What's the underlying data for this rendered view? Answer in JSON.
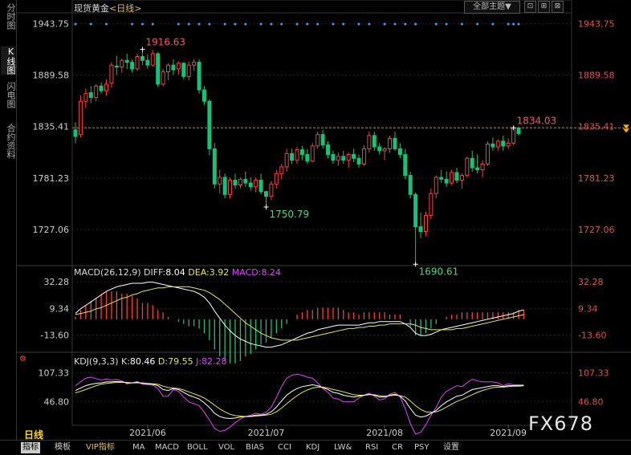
{
  "header": {
    "title": "现货黄金",
    "period_tag": "<日线>",
    "theme_button": "全部主题▼",
    "win_buttons": [
      "⊡",
      "⊞",
      "⊠"
    ]
  },
  "side_tabs": [
    "分时图",
    "K线图",
    "闪电图",
    "合约资料"
  ],
  "colors": {
    "up": "#ff3b3b",
    "down": "#18c07a",
    "last_line": "#ff6a00",
    "diff": "#ffffff",
    "dea": "#e8e83a",
    "macd_label": "#e040fb",
    "k": "#ffffff",
    "d": "#e8e83a",
    "j": "#e040fb",
    "marker": "#3aa0ff"
  },
  "chart_data": [
    {
      "type": "candlestick",
      "title": "现货黄金 <日线>",
      "y_ticks": [
        1943.75,
        1889.58,
        1835.41,
        1781.23,
        1727.06
      ],
      "ylim": [
        1690,
        1955
      ],
      "x_ticks": [
        "2021/06",
        "2021/07",
        "2021/08",
        "2021/09"
      ],
      "last_price": 1834.03,
      "annotations": [
        {
          "label": "1916.63",
          "value": 1916.63,
          "kind": "high"
        },
        {
          "label": "1750.79",
          "value": 1750.79,
          "kind": "low"
        },
        {
          "label": "1690.61",
          "value": 1690.61,
          "kind": "low"
        },
        {
          "label": "1834.03",
          "value": 1834.03,
          "kind": "high"
        }
      ],
      "candles": [
        [
          1832,
          1840,
          1818,
          1825
        ],
        [
          1827,
          1868,
          1824,
          1862
        ],
        [
          1862,
          1875,
          1855,
          1870
        ],
        [
          1871,
          1878,
          1860,
          1866
        ],
        [
          1866,
          1880,
          1862,
          1878
        ],
        [
          1878,
          1882,
          1870,
          1873
        ],
        [
          1873,
          1885,
          1868,
          1880
        ],
        [
          1881,
          1903,
          1876,
          1900
        ],
        [
          1899,
          1910,
          1890,
          1898
        ],
        [
          1898,
          1907,
          1892,
          1905
        ],
        [
          1905,
          1912,
          1896,
          1903
        ],
        [
          1903,
          1906,
          1892,
          1896
        ],
        [
          1896,
          1912,
          1894,
          1909
        ],
        [
          1909,
          1916,
          1900,
          1905
        ],
        [
          1905,
          1911,
          1896,
          1900
        ],
        [
          1900,
          1916,
          1898,
          1912
        ],
        [
          1912,
          1914,
          1877,
          1880
        ],
        [
          1880,
          1896,
          1878,
          1893
        ],
        [
          1893,
          1902,
          1884,
          1900
        ],
        [
          1900,
          1906,
          1890,
          1895
        ],
        [
          1896,
          1904,
          1890,
          1902
        ],
        [
          1902,
          1903,
          1885,
          1888
        ],
        [
          1888,
          1904,
          1884,
          1900
        ],
        [
          1900,
          1906,
          1894,
          1903
        ],
        [
          1903,
          1906,
          1870,
          1874
        ],
        [
          1874,
          1878,
          1858,
          1862
        ],
        [
          1862,
          1864,
          1805,
          1812
        ],
        [
          1812,
          1818,
          1770,
          1775
        ],
        [
          1775,
          1790,
          1765,
          1782
        ],
        [
          1782,
          1786,
          1760,
          1764
        ],
        [
          1764,
          1782,
          1760,
          1779
        ],
        [
          1779,
          1786,
          1770,
          1774
        ],
        [
          1774,
          1782,
          1770,
          1780
        ],
        [
          1780,
          1788,
          1772,
          1776
        ],
        [
          1776,
          1782,
          1768,
          1772
        ],
        [
          1772,
          1782,
          1766,
          1779
        ],
        [
          1779,
          1786,
          1764,
          1767
        ],
        [
          1767,
          1768,
          1750,
          1762
        ],
        [
          1762,
          1778,
          1758,
          1775
        ],
        [
          1775,
          1790,
          1770,
          1786
        ],
        [
          1786,
          1796,
          1780,
          1793
        ],
        [
          1793,
          1812,
          1788,
          1807
        ],
        [
          1807,
          1812,
          1796,
          1800
        ],
        [
          1800,
          1814,
          1796,
          1811
        ],
        [
          1811,
          1815,
          1800,
          1806
        ],
        [
          1806,
          1812,
          1796,
          1799
        ],
        [
          1799,
          1818,
          1798,
          1815
        ],
        [
          1815,
          1830,
          1812,
          1827
        ],
        [
          1827,
          1832,
          1812,
          1816
        ],
        [
          1816,
          1820,
          1802,
          1806
        ],
        [
          1806,
          1810,
          1796,
          1800
        ],
        [
          1800,
          1808,
          1794,
          1804
        ],
        [
          1804,
          1810,
          1796,
          1800
        ],
        [
          1800,
          1808,
          1792,
          1806
        ],
        [
          1806,
          1812,
          1798,
          1802
        ],
        [
          1802,
          1806,
          1792,
          1796
        ],
        [
          1796,
          1816,
          1794,
          1812
        ],
        [
          1812,
          1830,
          1808,
          1826
        ],
        [
          1826,
          1830,
          1810,
          1814
        ],
        [
          1814,
          1818,
          1806,
          1810
        ],
        [
          1810,
          1814,
          1800,
          1812
        ],
        [
          1812,
          1826,
          1808,
          1823
        ],
        [
          1823,
          1830,
          1810,
          1812
        ],
        [
          1812,
          1818,
          1802,
          1806
        ],
        [
          1806,
          1812,
          1780,
          1784
        ],
        [
          1784,
          1788,
          1760,
          1764
        ],
        [
          1764,
          1766,
          1692,
          1730
        ],
        [
          1730,
          1745,
          1718,
          1725
        ],
        [
          1725,
          1746,
          1720,
          1742
        ],
        [
          1742,
          1770,
          1738,
          1765
        ],
        [
          1765,
          1784,
          1760,
          1782
        ],
        [
          1782,
          1790,
          1776,
          1780
        ],
        [
          1780,
          1788,
          1772,
          1776
        ],
        [
          1776,
          1790,
          1774,
          1787
        ],
        [
          1787,
          1792,
          1776,
          1779
        ],
        [
          1779,
          1786,
          1770,
          1784
        ],
        [
          1784,
          1804,
          1782,
          1802
        ],
        [
          1802,
          1810,
          1788,
          1792
        ],
        [
          1792,
          1806,
          1786,
          1790
        ],
        [
          1790,
          1800,
          1782,
          1796
        ],
        [
          1796,
          1820,
          1794,
          1817
        ],
        [
          1817,
          1824,
          1810,
          1814
        ],
        [
          1814,
          1822,
          1810,
          1820
        ],
        [
          1820,
          1826,
          1810,
          1815
        ],
        [
          1815,
          1823,
          1812,
          1818
        ],
        [
          1818,
          1836,
          1816,
          1834
        ],
        [
          1834,
          1835,
          1826,
          1828
        ]
      ]
    },
    {
      "type": "macd",
      "title": "MACD(26,12,9)",
      "params": [
        26,
        12,
        9
      ],
      "values": {
        "DIFF": 8.04,
        "DEA": 3.92,
        "MACD": 8.24
      },
      "y_ticks": [
        32.28,
        9.34,
        -13.6
      ],
      "ylim": [
        -25,
        40
      ],
      "diff": [
        5,
        9,
        12,
        15,
        18,
        21,
        24,
        26,
        28,
        29,
        30,
        31,
        31,
        31,
        32,
        32,
        31,
        30,
        29,
        28,
        27,
        26,
        25,
        24,
        22,
        19,
        14,
        7,
        1,
        -5,
        -10,
        -14,
        -17,
        -19,
        -21,
        -22,
        -23,
        -24,
        -24,
        -23,
        -22,
        -20,
        -18,
        -16,
        -14,
        -12,
        -11,
        -9,
        -8,
        -7,
        -6,
        -5,
        -5,
        -5,
        -5,
        -5,
        -4,
        -3,
        -3,
        -2,
        -2,
        -2,
        -2,
        -2,
        -4,
        -7,
        -12,
        -14,
        -14,
        -13,
        -11,
        -9,
        -8,
        -7,
        -6,
        -5,
        -4,
        -3,
        -2,
        -1,
        0,
        1,
        2,
        3,
        4,
        5,
        7,
        8
      ],
      "dea": [
        4,
        5,
        6,
        7,
        9,
        10,
        12,
        14,
        16,
        18,
        19,
        21,
        22,
        24,
        25,
        26,
        27,
        27,
        28,
        28,
        28,
        28,
        28,
        27,
        26,
        25,
        23,
        20,
        17,
        13,
        9,
        5,
        1,
        -3,
        -6,
        -9,
        -12,
        -14,
        -16,
        -17,
        -18,
        -18,
        -18,
        -18,
        -17,
        -16,
        -15,
        -14,
        -13,
        -12,
        -11,
        -10,
        -9,
        -8,
        -8,
        -7,
        -7,
        -6,
        -6,
        -5,
        -5,
        -4,
        -4,
        -4,
        -4,
        -4,
        -5,
        -7,
        -8,
        -9,
        -9,
        -9,
        -9,
        -9,
        -8,
        -8,
        -7,
        -6,
        -5,
        -4,
        -3,
        -2,
        -1,
        0,
        1,
        2,
        3,
        4
      ]
    },
    {
      "type": "kdj",
      "title": "KDJ(9,3,3)",
      "params": [
        9,
        3,
        3
      ],
      "values": {
        "K": 80.46,
        "D": 79.55,
        "J": 82.28
      },
      "y_ticks": [
        107.33,
        46.8
      ],
      "ylim": [
        0,
        125
      ],
      "k": [
        70,
        75,
        80,
        83,
        85,
        86,
        88,
        88,
        89,
        88,
        86,
        86,
        87,
        85,
        84,
        83,
        80,
        72,
        70,
        74,
        72,
        66,
        60,
        56,
        52,
        44,
        34,
        22,
        15,
        12,
        11,
        12,
        14,
        15,
        16,
        18,
        18,
        20,
        25,
        35,
        48,
        60,
        68,
        74,
        78,
        80,
        82,
        80,
        76,
        72,
        66,
        64,
        60,
        58,
        56,
        58,
        60,
        62,
        60,
        56,
        56,
        60,
        62,
        58,
        48,
        32,
        18,
        14,
        16,
        22,
        28,
        38,
        46,
        52,
        58,
        60,
        66,
        72,
        74,
        76,
        78,
        80,
        80,
        78,
        80,
        80,
        80,
        80
      ],
      "d": [
        65,
        68,
        72,
        76,
        80,
        83,
        85,
        86,
        87,
        87,
        87,
        86,
        86,
        86,
        85,
        84,
        83,
        79,
        76,
        75,
        74,
        71,
        67,
        63,
        59,
        54,
        47,
        39,
        31,
        25,
        20,
        17,
        16,
        15,
        15,
        16,
        17,
        18,
        20,
        25,
        33,
        42,
        51,
        59,
        66,
        71,
        75,
        77,
        77,
        75,
        72,
        70,
        67,
        64,
        61,
        60,
        60,
        61,
        61,
        59,
        58,
        59,
        60,
        59,
        56,
        48,
        38,
        30,
        25,
        24,
        25,
        29,
        35,
        41,
        47,
        51,
        56,
        61,
        66,
        70,
        73,
        76,
        77,
        77,
        78,
        79,
        79,
        80
      ],
      "j": [
        80,
        88,
        96,
        98,
        95,
        92,
        94,
        92,
        93,
        90,
        84,
        86,
        89,
        83,
        82,
        81,
        74,
        58,
        58,
        72,
        68,
        56,
        46,
        42,
        38,
        24,
        8,
        -10,
        -16,
        -14,
        -7,
        2,
        10,
        15,
        18,
        22,
        20,
        24,
        35,
        55,
        78,
        96,
        102,
        104,
        102,
        98,
        96,
        86,
        74,
        66,
        54,
        52,
        46,
        46,
        46,
        54,
        60,
        64,
        58,
        50,
        52,
        62,
        66,
        56,
        32,
        0,
        -22,
        -18,
        -2,
        18,
        34,
        56,
        68,
        74,
        80,
        78,
        86,
        94,
        90,
        88,
        88,
        88,
        86,
        80,
        84,
        82,
        82,
        82
      ]
    }
  ],
  "bottom_tabs": [
    "指标",
    "模板",
    "VIP指标",
    "MA",
    "MACD",
    "BOLL",
    "VOL",
    "BIAS",
    "CCI",
    "KDJ",
    "LW&",
    "RSI",
    "CR",
    "PSY",
    "设置"
  ],
  "period_label": "日线",
  "watermark": "FX678"
}
